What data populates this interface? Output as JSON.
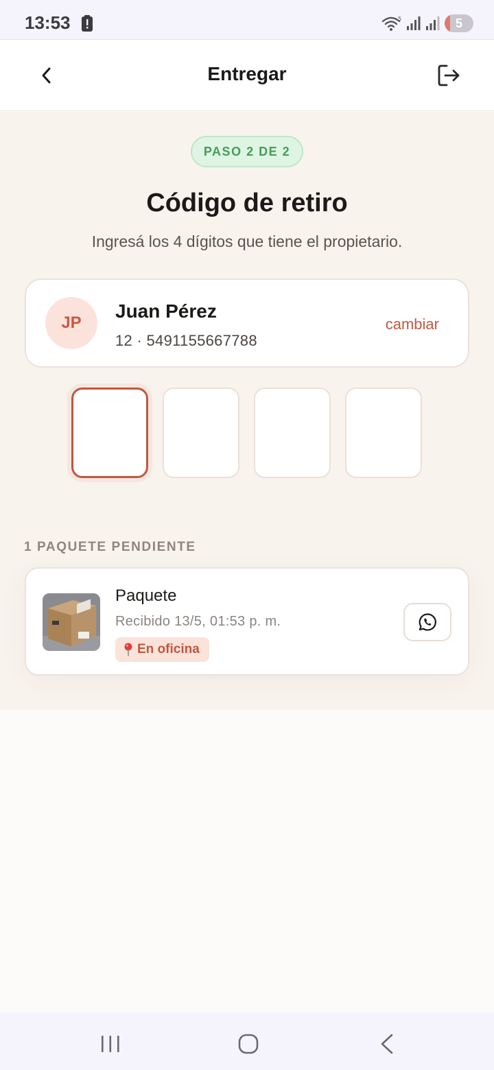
{
  "status_bar": {
    "time": "13:53",
    "battery_level": "5",
    "icons": [
      "battery-alert-icon",
      "wifi-icon",
      "signal-icon",
      "signal-icon-2",
      "battery-icon"
    ]
  },
  "header": {
    "title": "Entregar",
    "back_icon": "chevron-left-icon",
    "logout_icon": "logout-icon"
  },
  "step": {
    "label": "PASO 2 DE 2"
  },
  "page": {
    "title": "Código de retiro",
    "subtitle": "Ingresá los 4 dígitos que tiene el propietario."
  },
  "owner": {
    "initials": "JP",
    "name": "Juan Pérez",
    "info": "12 · 5491155667788",
    "change_label": "cambiar"
  },
  "code": {
    "digits": [
      "",
      "",
      "",
      ""
    ],
    "active_index": 0
  },
  "packages": {
    "section_label": "1 PAQUETE PENDIENTE",
    "items": [
      {
        "name": "Paquete",
        "received": "Recibido 13/5, 01:53 p. m.",
        "location": "En oficina",
        "action_icon": "whatsapp-icon"
      }
    ]
  },
  "nav_bar": {
    "icons": [
      "recents-icon",
      "home-icon",
      "back-icon"
    ]
  },
  "colors": {
    "accent": "#c0573f",
    "success": "#4a9a5c",
    "background": "#f9f3ee"
  }
}
